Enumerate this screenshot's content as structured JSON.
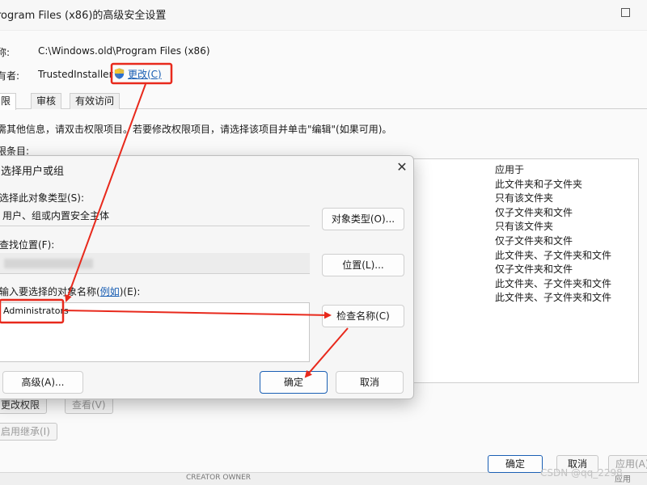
{
  "background_window": {
    "title": "rogram Files (x86)的高级安全设置",
    "name_label": "称:",
    "name_value": "C:\\Windows.old\\Program Files (x86)",
    "owner_label": "有者:",
    "owner_value": "TrustedInstaller",
    "change_link": "更改(C)",
    "tabs": [
      "限",
      "审核",
      "有效访问"
    ],
    "info_text": "需其他信息，请双击权限项目。若要修改权限项目，请选择该项目并单击\"编辑\"(如果可用)。",
    "entries_label": "限条目:",
    "applies_to": [
      "应用于",
      "此文件夹和子文件夹",
      "只有该文件夹",
      "仅子文件夹和文件",
      "只有该文件夹",
      "仅子文件夹和文件",
      "此文件夹、子文件夹和文件",
      "仅子文件夹和文件",
      "此文件夹、子文件夹和文件",
      "此文件夹、子文件夹和文件"
    ],
    "change_permissions_button": "更改权限",
    "view_button": "查看(V)",
    "enable_inheritance_button": "启用继承(I)",
    "bottom_row_text": "CREATOR OWNER",
    "bottom_row_right": "应用",
    "ok_button": "确定",
    "cancel_button": "取消",
    "apply_button": "应用(A)",
    "watermark": "CSDN @qq_2298"
  },
  "dialog": {
    "title": "选择用户或组",
    "close_glyph": "✕",
    "object_type_label": "选择此对象类型(S):",
    "object_type_value": "用户、组或内置安全主体",
    "object_types_button": "对象类型(O)...",
    "location_label": "查找位置(F):",
    "locations_button": "位置(L)...",
    "enter_names_prefix": "输入要选择的对象名称(",
    "example_link": "例如",
    "enter_names_suffix": ")(E):",
    "names_value": "Administrators",
    "check_names_button": "检查名称(C)",
    "advanced_button": "高级(A)...",
    "ok_button": "确定",
    "cancel_button": "取消"
  },
  "colors": {
    "annotation_red": "#e8291c",
    "link_blue": "#1a5fb4"
  }
}
